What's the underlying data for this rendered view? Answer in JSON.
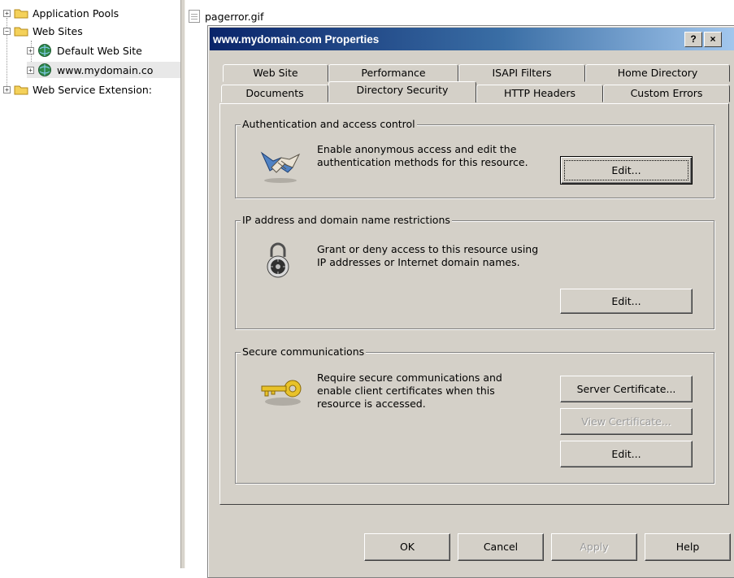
{
  "tree": {
    "items": [
      {
        "label": "Application Pools",
        "expander": "+",
        "type": "folder"
      },
      {
        "label": "Web Sites",
        "expander": "−",
        "type": "folder"
      },
      {
        "label": "Default Web Site",
        "expander": "+",
        "type": "globe"
      },
      {
        "label": "www.mydomain.co",
        "expander": "+",
        "type": "globe"
      },
      {
        "label": "Web Service Extension:",
        "expander": "+",
        "type": "folder"
      }
    ]
  },
  "file_list": {
    "item": "pagerror.gif"
  },
  "dialog": {
    "title": "www.mydomain.com Properties",
    "help_button": "?",
    "close_button": "×",
    "tabs_back": [
      "Web Site",
      "Performance",
      "ISAPI Filters",
      "Home Directory"
    ],
    "tabs_front": [
      "Documents",
      "Directory Security",
      "HTTP Headers",
      "Custom Errors"
    ],
    "active_tab": "Directory Security",
    "groups": {
      "auth": {
        "legend": "Authentication and access control",
        "text": "Enable anonymous access and edit the\nauthentication methods for this resource.",
        "edit": "Edit..."
      },
      "ip": {
        "legend": "IP address and domain name restrictions",
        "text": "Grant or deny access to this resource using\nIP addresses or Internet domain names.",
        "edit": "Edit..."
      },
      "secure": {
        "legend": "Secure communications",
        "text": "Require secure communications and\nenable client certificates when this\nresource is accessed.",
        "server_cert": "Server Certificate...",
        "view_cert": "View Certificate...",
        "edit": "Edit..."
      }
    },
    "footer": {
      "ok": "OK",
      "cancel": "Cancel",
      "apply": "Apply",
      "help": "Help"
    }
  },
  "colors": {
    "titlebar_start": "#0a246a",
    "titlebar_end": "#a6caf0",
    "face": "#d4d0c8"
  }
}
